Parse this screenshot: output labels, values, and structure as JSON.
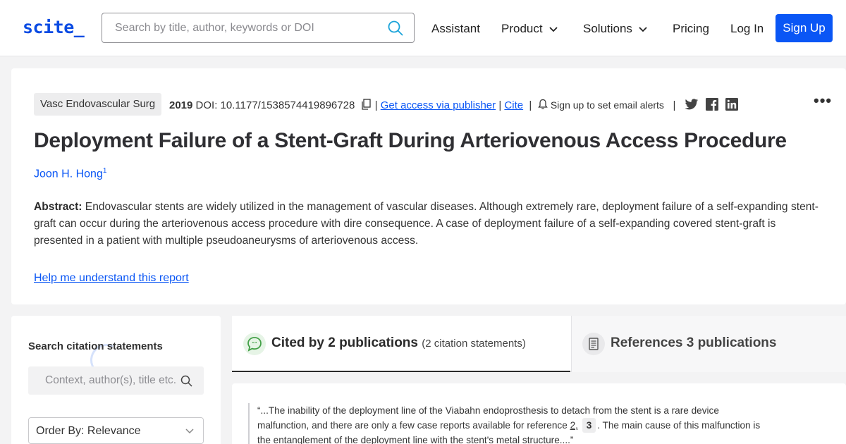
{
  "header": {
    "logo": "scite_",
    "search_placeholder": "Search by title, author, keywords or DOI",
    "nav": [
      {
        "label": "Assistant"
      },
      {
        "label": "Product"
      },
      {
        "label": "Solutions"
      },
      {
        "label": "Pricing"
      },
      {
        "label": "Log In"
      }
    ],
    "signup_label": "Sign Up"
  },
  "article": {
    "journal": "Vasc Endovascular Surg",
    "year": "2019",
    "doi": "DOI: 10.1177/1538574419896728",
    "access_link": "Get access via publisher",
    "cite_link": "Cite",
    "alert_text": "Sign up to set email alerts",
    "more_label": "•••",
    "title": "Deployment Failure of a Stent-Graft During Arteriovenous Access Procedure",
    "author": "Joon H. Hong",
    "author_sup": "1",
    "abstract_label": "Abstract:",
    "abstract_text": "Endovascular stents are widely utilized in the management of vascular diseases. Although extremely rare, deployment failure of a self-expanding stent-graft can occur during the arteriovenous access procedure with dire consequence. A case of deployment failure of a self-expanding covered stent-graft is presented in a patient with multiple pseudoaneurysms of arteriovenous access.",
    "help_link": "Help me understand this report"
  },
  "sidebar": {
    "title": "Search citation statements",
    "context_placeholder": "Context, author(s), title etc.",
    "order_label": "Order By: Relevance"
  },
  "tabs": {
    "cited_label": "Cited by 2 publications",
    "cited_sub": "(2 citation statements)",
    "refs_label": "References 3 publications"
  },
  "citation": {
    "quote_part1": "“...The inability of the deployment line of the Viabahn endoprosthesis to detach from the stent is a rare device malfunction, and there are only a few case reports available for reference ",
    "ref_link": "2,",
    "ref_box": "3",
    "quote_part2": ". The main cause of this malfunction is the entanglement of the deployment line with the stent's metal structure....”"
  },
  "colors": {
    "brand": "#0a56f5",
    "cited_icon": "#4caf50"
  }
}
